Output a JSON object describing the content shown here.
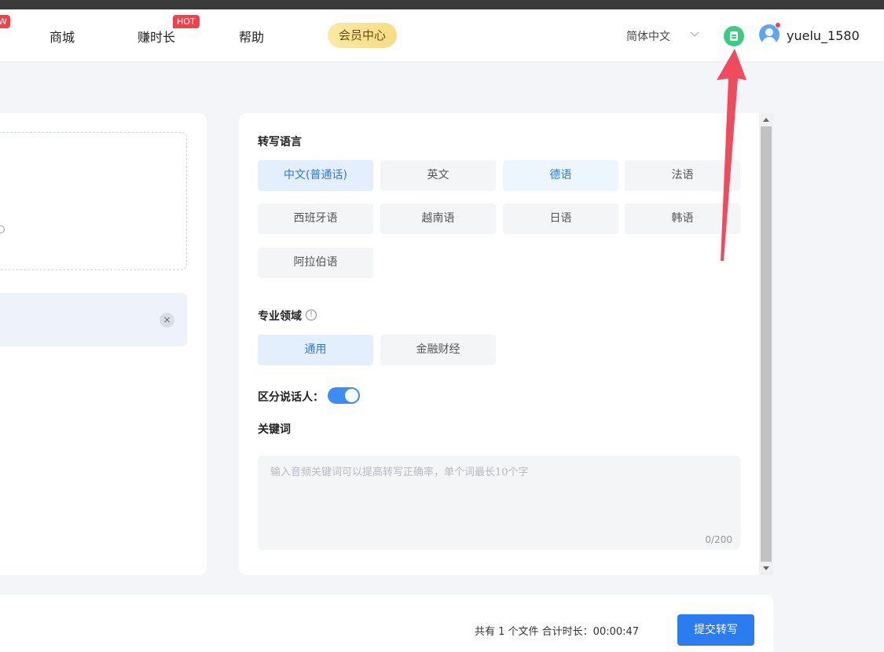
{
  "nav": {
    "new_badge": "W",
    "store": "商城",
    "earn_time": "赚时长",
    "hot_badge": "HOT",
    "help": "帮助",
    "member_center": "会员中心",
    "language": "简体中文",
    "username": "yuelu_1580"
  },
  "upload": {
    "close_symbol": "×"
  },
  "settings": {
    "language_title": "转写语言",
    "languages": [
      "中文(普通话)",
      "英文",
      "德语",
      "法语",
      "西班牙语",
      "越南语",
      "日语",
      "韩语",
      "阿拉伯语"
    ],
    "selected_language": "中文(普通话)",
    "domain_title": "专业领域",
    "domain_info_symbol": "!",
    "domains": [
      "通用",
      "金融财经"
    ],
    "selected_domain": "通用",
    "speaker_label": "区分说话人：",
    "speaker_enabled": true,
    "keywords_title": "关键词",
    "keywords_placeholder": "输入音频关键词可以提高转写正确率，单个词最长10个字",
    "keywords_count": "0/200"
  },
  "footer": {
    "summary": "共有 1 个文件 合计时长：00:00:47",
    "submit": "提交转写"
  },
  "colors": {
    "accent": "#2b7cf0",
    "badge": "#f5404a",
    "annotation_arrow": "#f04b5d"
  }
}
